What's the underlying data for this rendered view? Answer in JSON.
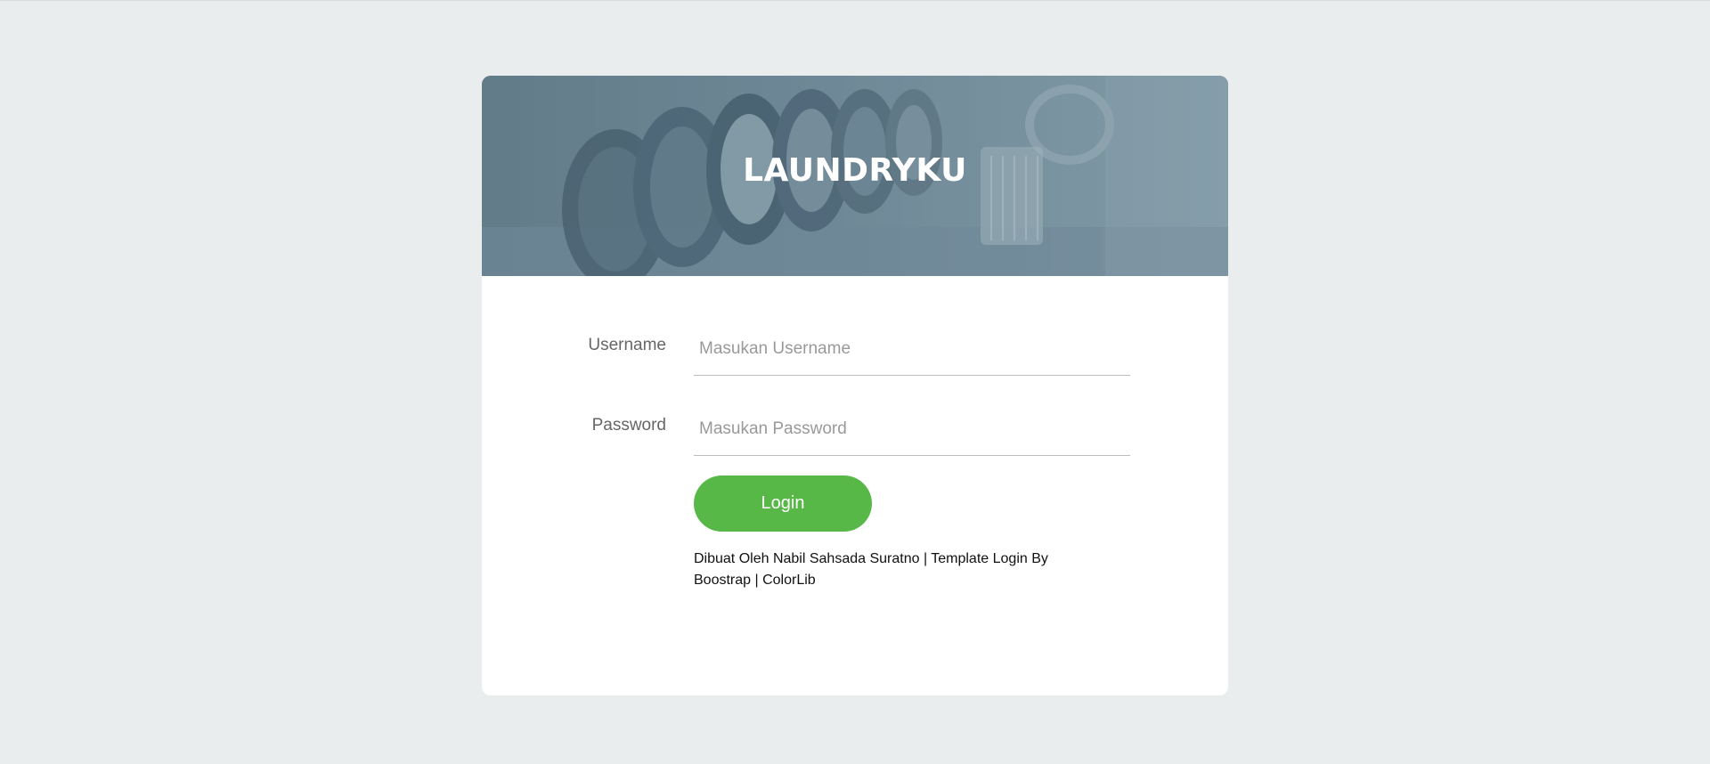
{
  "app": {
    "title": "LAUNDRYKU"
  },
  "form": {
    "username": {
      "label": "Username",
      "placeholder": "Masukan Username",
      "value": ""
    },
    "password": {
      "label": "Password",
      "placeholder": "Masukan Password",
      "value": ""
    },
    "login_label": "Login"
  },
  "footer": {
    "credit": "Dibuat Oleh Nabil Sahsada Suratno | Template Login By Boostrap | ColorLib"
  },
  "colors": {
    "page_background": "#e9edee",
    "hero_overlay": "#6d8796",
    "accent_button": "#57b847",
    "card_background": "#ffffff"
  }
}
